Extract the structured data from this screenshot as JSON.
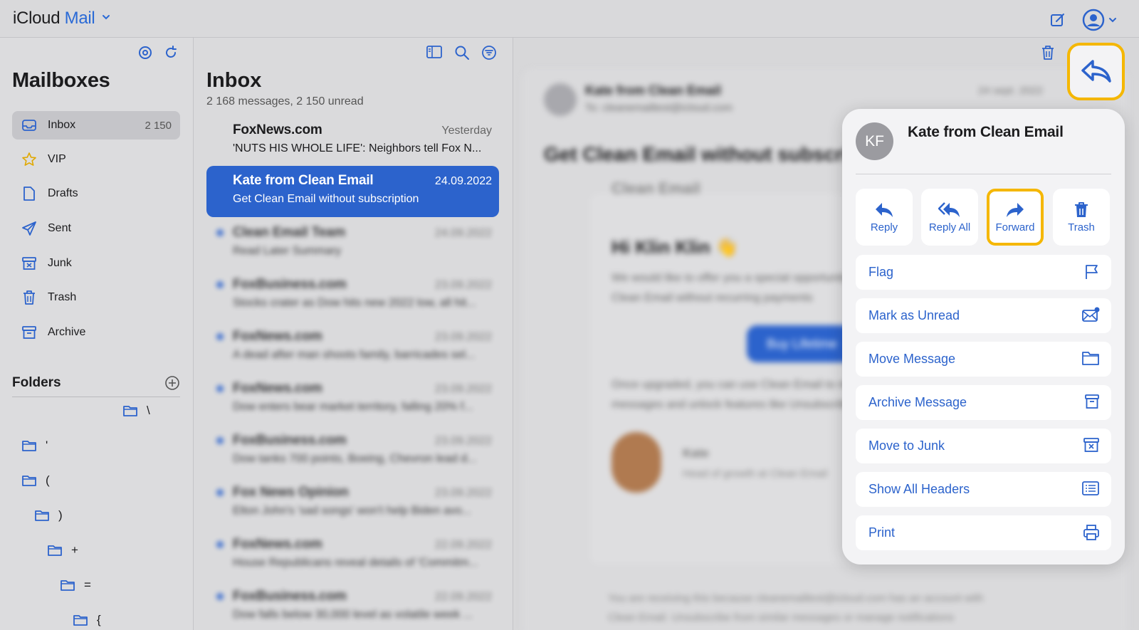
{
  "header": {
    "brand_icloud": "iCloud",
    "brand_mail": "Mail"
  },
  "sidebar": {
    "title": "Mailboxes",
    "items": [
      {
        "label": "Inbox",
        "count": "2 150",
        "icon": "inbox-icon"
      },
      {
        "label": "VIP",
        "count": "",
        "icon": "star-icon"
      },
      {
        "label": "Drafts",
        "count": "",
        "icon": "document-icon"
      },
      {
        "label": "Sent",
        "count": "",
        "icon": "paper-plane-icon"
      },
      {
        "label": "Junk",
        "count": "",
        "icon": "junk-box-icon"
      },
      {
        "label": "Trash",
        "count": "",
        "icon": "trash-icon"
      },
      {
        "label": "Archive",
        "count": "",
        "icon": "archive-box-icon"
      }
    ],
    "folders_title": "Folders",
    "folders": [
      "\\",
      "'",
      "(",
      ")",
      "+",
      "=",
      "{"
    ]
  },
  "list": {
    "title": "Inbox",
    "subtitle": "2 168 messages, 2 150 unread",
    "rows": [
      {
        "from": "FoxNews.com",
        "date": "Yesterday",
        "subject": "'NUTS HIS WHOLE LIFE': Neighbors tell Fox N..."
      },
      {
        "from": "Kate from Clean Email",
        "date": "24.09.2022",
        "subject": "Get Clean Email without subscription"
      },
      {
        "from": "Clean Email Team",
        "date": "24.09.2022",
        "subject": "Read Later Summary"
      },
      {
        "from": "FoxBusiness.com",
        "date": "23.09.2022",
        "subject": "Stocks crater as Dow hits new 2022 low, all hit..."
      },
      {
        "from": "FoxNews.com",
        "date": "23.09.2022",
        "subject": "A dead after man shoots family, barricades sel..."
      },
      {
        "from": "FoxNews.com",
        "date": "23.09.2022",
        "subject": "Dow enters bear market territory, falling 20% f..."
      },
      {
        "from": "FoxBusiness.com",
        "date": "23.09.2022",
        "subject": "Dow tanks 700 points, Boeing, Chevron lead d..."
      },
      {
        "from": "Fox News Opinion",
        "date": "23.09.2022",
        "subject": "Elton John's 'sad songs' won't help Biden avo..."
      },
      {
        "from": "FoxNews.com",
        "date": "22.09.2022",
        "subject": "House Republicans reveal details of 'Commitm..."
      },
      {
        "from": "FoxBusiness.com",
        "date": "22.09.2022",
        "subject": "Dow falls below 30,000 level as volatile week ..."
      }
    ]
  },
  "reader": {
    "from": "Kate from Clean Email",
    "to": "To: cleanemailtest@icloud.com",
    "date": "24 sept. 2022",
    "subject": "Get Clean Email without subscription",
    "logo": "Clean Email",
    "greeting": "Hi Klin Klin 👋",
    "body1": "We would like to offer you a special opportunity...",
    "body2": "Clean Email without recurring payments",
    "button": "Buy Lifetime",
    "body3": "Once upgraded, you can use Clean Email to manage",
    "body4": "messages and unlock features like Unsubscriber",
    "sig_name": "Kate",
    "sig_role": "Head of growth at Clean Email",
    "footer1": "You are receiving this because cleanemailtest@icloud.com has an account with",
    "footer2": "Clean Email. Unsubscribe from similar messages or manage notifications"
  },
  "popover": {
    "initials": "KF",
    "name": "Kate from Clean Email",
    "quick": [
      {
        "label": "Reply",
        "icon": "reply-icon"
      },
      {
        "label": "Reply All",
        "icon": "reply-all-icon"
      },
      {
        "label": "Forward",
        "icon": "forward-icon"
      },
      {
        "label": "Trash",
        "icon": "trash-icon"
      }
    ],
    "actions": [
      {
        "label": "Flag",
        "icon": "flag-icon"
      },
      {
        "label": "Mark as Unread",
        "icon": "envelope-badge-icon"
      },
      {
        "label": "Move Message",
        "icon": "folder-icon"
      },
      {
        "label": "Archive Message",
        "icon": "archive-box-icon"
      },
      {
        "label": "Move to Junk",
        "icon": "junk-box-icon"
      },
      {
        "label": "Show All Headers",
        "icon": "list-icon"
      },
      {
        "label": "Print",
        "icon": "printer-icon"
      }
    ]
  },
  "colors": {
    "accent": "#2c63cc",
    "highlight": "#f5b700"
  }
}
